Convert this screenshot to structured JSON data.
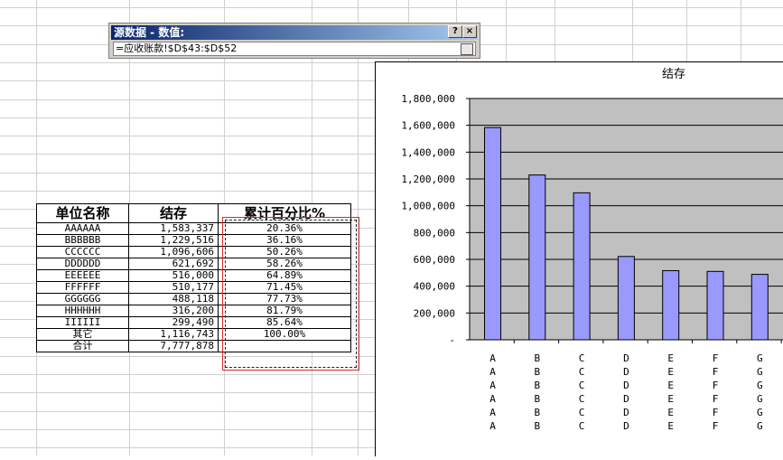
{
  "dialog": {
    "title": "源数据 - 数值:",
    "help_label": "?",
    "close_label": "×",
    "reference": "=应收账款!$D$43:$D$52"
  },
  "table": {
    "headers": [
      "单位名称",
      "结存",
      "累计百分比%"
    ],
    "rows": [
      [
        "AAAAAA",
        "1,583,337",
        "20.36%"
      ],
      [
        "BBBBBB",
        "1,229,516",
        "36.16%"
      ],
      [
        "CCCCCC",
        "1,096,606",
        "50.26%"
      ],
      [
        "DDDDDD",
        "621,692",
        "58.26%"
      ],
      [
        "EEEEEE",
        "516,000",
        "64.89%"
      ],
      [
        "FFFFFF",
        "510,177",
        "71.45%"
      ],
      [
        "GGGGGG",
        "488,118",
        "77.73%"
      ],
      [
        "HHHHHH",
        "316,200",
        "81.79%"
      ],
      [
        "IIIIII",
        "299,490",
        "85.64%"
      ],
      [
        "其它",
        "1,116,743",
        "100.00%"
      ],
      [
        "合计",
        "7,777,878",
        ""
      ]
    ]
  },
  "colors": {
    "bar_fill": "#9999ff",
    "plot_area": "#c0c0c0",
    "selection_border": "#d32d2d"
  },
  "chart_data": {
    "type": "bar",
    "title": "结存",
    "categories": [
      "A",
      "B",
      "C",
      "D",
      "E",
      "F",
      "G"
    ],
    "category_label_lines": [
      [
        "A",
        "A",
        "A",
        "A",
        "A",
        "A"
      ],
      [
        "B",
        "B",
        "B",
        "B",
        "B",
        "B"
      ],
      [
        "C",
        "C",
        "C",
        "C",
        "C",
        "C"
      ],
      [
        "D",
        "D",
        "D",
        "D",
        "D",
        "D"
      ],
      [
        "E",
        "E",
        "E",
        "E",
        "E",
        "E"
      ],
      [
        "F",
        "F",
        "F",
        "F",
        "F",
        "F"
      ],
      [
        "G",
        "G",
        "G",
        "G",
        "G",
        "G"
      ]
    ],
    "values": [
      1583337,
      1229516,
      1096606,
      621692,
      516000,
      510177,
      488118
    ],
    "ylim": [
      0,
      1800000
    ],
    "yticks": [
      "-",
      "200,000",
      "400,000",
      "600,000",
      "800,000",
      "1,000,000",
      "1,200,000",
      "1,400,000",
      "1,600,000",
      "1,800,000"
    ],
    "grid": true,
    "legend": "none"
  }
}
